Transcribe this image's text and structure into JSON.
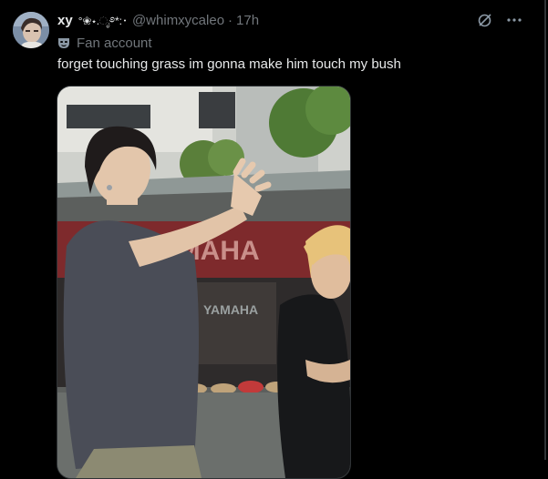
{
  "author": {
    "display_name": "xy",
    "name_decoration": "°❀⋆.ೃ࿔*:･",
    "handle": "@whimxycaleo",
    "separator": "·",
    "timestamp": "17h",
    "affiliation": "Fan account"
  },
  "tweet": {
    "text": "forget touching grass im gonna make him touch my bush"
  },
  "media": {
    "sign_text": "AMAHA",
    "inner_sign_text": "YAMAHA"
  },
  "icons": {
    "affiliation": "mask-icon",
    "grok": "grok-icon",
    "more": "more-icon"
  },
  "colors": {
    "background": "#000000",
    "primary_text": "#e7e9ea",
    "secondary_text": "#71767b",
    "border": "#2f3336"
  }
}
